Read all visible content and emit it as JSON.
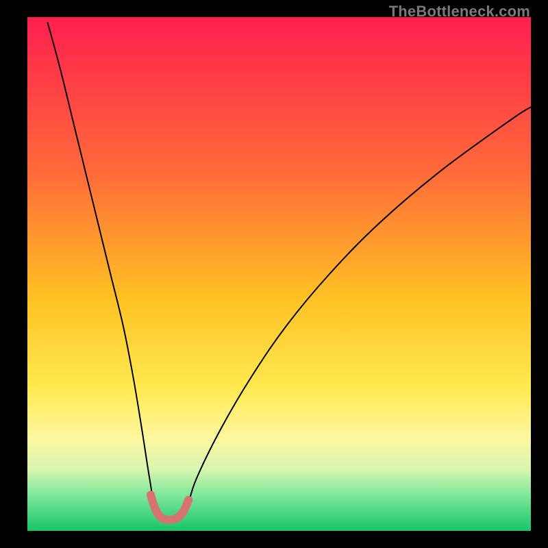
{
  "watermark": "TheBottleneck.com",
  "chart_data": {
    "type": "line",
    "title": "",
    "xlabel": "",
    "ylabel": "",
    "xlim": [
      0,
      100
    ],
    "ylim": [
      0,
      100
    ],
    "background_gradient_stops": [
      {
        "offset": 0,
        "color": "#ff1f4f"
      },
      {
        "offset": 30,
        "color": "#ff6a3a"
      },
      {
        "offset": 55,
        "color": "#ffc224"
      },
      {
        "offset": 72,
        "color": "#ffe94f"
      },
      {
        "offset": 82,
        "color": "#fdf7a0"
      },
      {
        "offset": 88,
        "color": "#d8f6b0"
      },
      {
        "offset": 93,
        "color": "#7fe79b"
      },
      {
        "offset": 100,
        "color": "#18c666"
      }
    ],
    "series": [
      {
        "name": "bottleneck-curve",
        "color": "#000000",
        "stroke_width": 2,
        "points": [
          {
            "x": 4.0,
            "y": 99.0
          },
          {
            "x": 6.5,
            "y": 90.0
          },
          {
            "x": 9.0,
            "y": 80.0
          },
          {
            "x": 11.5,
            "y": 70.0
          },
          {
            "x": 14.0,
            "y": 60.0
          },
          {
            "x": 16.5,
            "y": 50.0
          },
          {
            "x": 19.0,
            "y": 40.0
          },
          {
            "x": 21.0,
            "y": 30.0
          },
          {
            "x": 22.7,
            "y": 20.0
          },
          {
            "x": 24.3,
            "y": 10.0
          },
          {
            "x": 25.5,
            "y": 4.0
          },
          {
            "x": 27.5,
            "y": 2.2
          },
          {
            "x": 29.5,
            "y": 2.2
          },
          {
            "x": 31.5,
            "y": 4.0
          },
          {
            "x": 33.5,
            "y": 10.0
          },
          {
            "x": 38.5,
            "y": 20.0
          },
          {
            "x": 44.5,
            "y": 30.0
          },
          {
            "x": 51.5,
            "y": 40.0
          },
          {
            "x": 60.0,
            "y": 50.0
          },
          {
            "x": 70.0,
            "y": 60.0
          },
          {
            "x": 82.0,
            "y": 70.0
          },
          {
            "x": 96.0,
            "y": 80.0
          },
          {
            "x": 100.0,
            "y": 82.5
          }
        ]
      },
      {
        "name": "highlighted-minimum",
        "color": "#d6736f",
        "stroke_width": 12,
        "marker_radius": 6,
        "points": [
          {
            "x": 24.5,
            "y": 7.0
          },
          {
            "x": 25.3,
            "y": 4.5
          },
          {
            "x": 26.3,
            "y": 2.8
          },
          {
            "x": 27.5,
            "y": 2.2
          },
          {
            "x": 28.7,
            "y": 2.2
          },
          {
            "x": 29.9,
            "y": 2.6
          },
          {
            "x": 31.0,
            "y": 3.8
          },
          {
            "x": 32.0,
            "y": 6.0
          }
        ]
      }
    ]
  }
}
